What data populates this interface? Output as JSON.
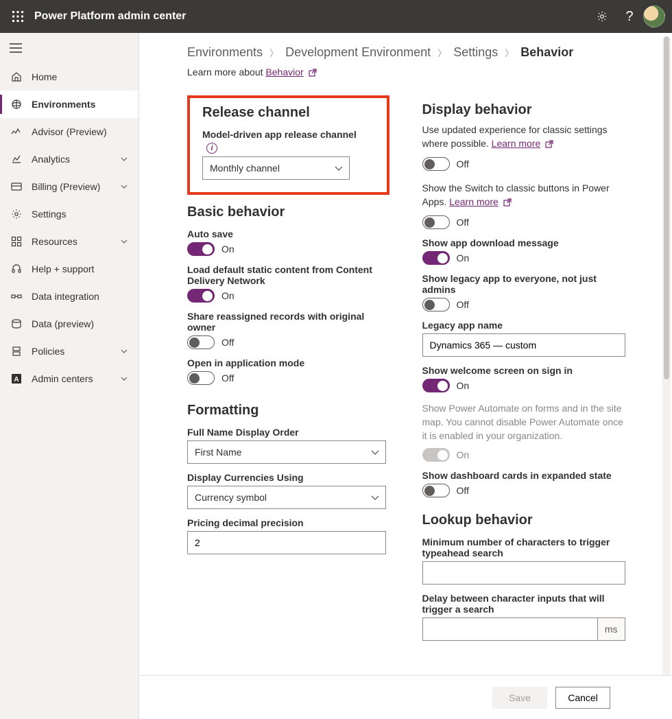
{
  "header": {
    "app_title": "Power Platform admin center"
  },
  "sidebar": {
    "items": [
      {
        "label": "Home",
        "icon": "home"
      },
      {
        "label": "Environments",
        "icon": "environments",
        "selected": true
      },
      {
        "label": "Advisor (Preview)",
        "icon": "advisor"
      },
      {
        "label": "Analytics",
        "icon": "analytics",
        "expandable": true
      },
      {
        "label": "Billing (Preview)",
        "icon": "billing",
        "expandable": true
      },
      {
        "label": "Settings",
        "icon": "settings"
      },
      {
        "label": "Resources",
        "icon": "resources",
        "expandable": true
      },
      {
        "label": "Help + support",
        "icon": "help"
      },
      {
        "label": "Data integration",
        "icon": "dataint"
      },
      {
        "label": "Data (preview)",
        "icon": "datapv"
      },
      {
        "label": "Policies",
        "icon": "policies",
        "expandable": true
      },
      {
        "label": "Admin centers",
        "icon": "adminc",
        "expandable": true
      }
    ]
  },
  "breadcrumb": {
    "items": [
      "Environments",
      "Development Environment",
      "Settings"
    ],
    "current": "Behavior"
  },
  "learn_more_prefix": "Learn more about ",
  "learn_more_link": "Behavior",
  "release": {
    "title": "Release channel",
    "label": "Model-driven app release channel",
    "value": "Monthly channel"
  },
  "basic": {
    "title": "Basic behavior",
    "auto_save_label": "Auto save",
    "auto_save_state": "On",
    "cdn_label": "Load default static content from Content Delivery Network",
    "cdn_state": "On",
    "share_label": "Share reassigned records with original owner",
    "share_state": "Off",
    "appmode_label": "Open in application mode",
    "appmode_state": "Off"
  },
  "formatting": {
    "title": "Formatting",
    "name_order_label": "Full Name Display Order",
    "name_order_value": "First Name",
    "currency_label": "Display Currencies Using",
    "currency_value": "Currency symbol",
    "precision_label": "Pricing decimal precision",
    "precision_value": "2"
  },
  "display": {
    "title": "Display behavior",
    "updated_exp_text": "Use updated experience for classic settings where possible. ",
    "updated_exp_link": "Learn more",
    "updated_exp_state": "Off",
    "switch_text": "Show the Switch to classic buttons in Power Apps. ",
    "switch_link": "Learn more",
    "switch_state": "Off",
    "download_label": "Show app download message",
    "download_state": "On",
    "legacy_all_label": "Show legacy app to everyone, not just admins",
    "legacy_all_state": "Off",
    "legacy_name_label": "Legacy app name",
    "legacy_name_value": "Dynamics 365 — custom",
    "welcome_label": "Show welcome screen on sign in",
    "welcome_state": "On",
    "pauto_text": "Show Power Automate on forms and in the site map. You cannot disable Power Automate once it is enabled in your organization.",
    "pauto_state": "On",
    "dashboard_label": "Show dashboard cards in expanded state",
    "dashboard_state": "Off"
  },
  "lookup": {
    "title": "Lookup behavior",
    "min_chars_label": "Minimum number of characters to trigger typeahead search",
    "min_chars_value": "",
    "delay_label": "Delay between character inputs that will trigger a search",
    "delay_value": "",
    "delay_suffix": "ms"
  },
  "footer": {
    "save": "Save",
    "cancel": "Cancel"
  }
}
